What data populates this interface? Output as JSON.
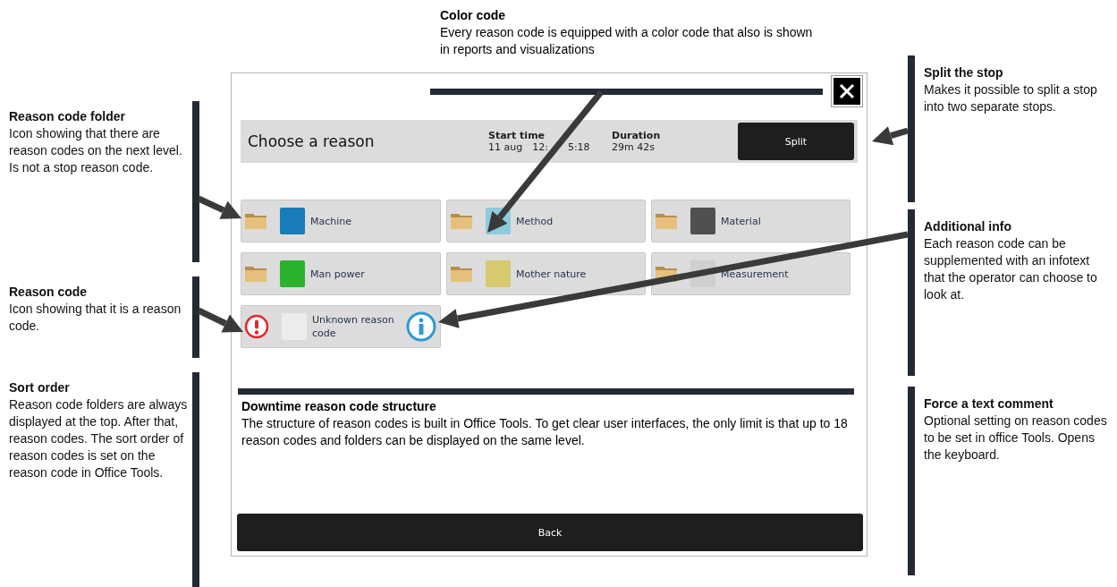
{
  "top_annotation": {
    "title": "Color code",
    "text": "Every reason code is equipped with a color code that also is shown in reports and visualizations"
  },
  "left_annotations": [
    {
      "title": "Reason code folder",
      "text": "Icon showing that there are reason codes on the next level. Is not a stop reason code."
    },
    {
      "title": "Reason code",
      "text": "Icon showing that it is a reason code."
    },
    {
      "title": "Sort order",
      "text": "Reason code folders are always displayed at the top. After that, reason codes. The sort order of reason codes is set on the reason code in Office Tools."
    }
  ],
  "right_annotations": [
    {
      "title": "Split the stop",
      "text": "Makes it possible to split a stop into two separate stops."
    },
    {
      "title": "Additional info",
      "text": "Each reason code can be supplemented with an infotext that the operator can choose to look at."
    },
    {
      "title": "Force a text comment",
      "text": "Optional setting on reason codes to be set in office Tools. Opens the keyboard."
    }
  ],
  "dialog": {
    "title": "Choose a reason",
    "start_time_label": "Start time",
    "start_time_date": "11 aug",
    "start_time_visible": [
      "12:",
      "5:18"
    ],
    "duration_label": "Duration",
    "duration_value": "29m 42s",
    "split_button": "Split",
    "reasons": [
      {
        "kind": "folder",
        "label": "Machine",
        "color": "#1a7bb9",
        "info": false
      },
      {
        "kind": "folder",
        "label": "Method",
        "color": "#8fcbdf",
        "info": false
      },
      {
        "kind": "folder",
        "label": "Material",
        "color": "#505050",
        "info": false
      },
      {
        "kind": "folder",
        "label": "Man power",
        "color": "#2bb32e",
        "info": false
      },
      {
        "kind": "folder",
        "label": "Mother nature",
        "color": "#d6c96f",
        "info": false
      },
      {
        "kind": "folder",
        "label": "Measurement",
        "color": "#cfcfcf",
        "info": false
      },
      {
        "kind": "code",
        "label": "Unknown reason code",
        "color": "#ececec",
        "info": true
      }
    ],
    "structure_note": {
      "title": "Downtime reason code structure",
      "text": "The structure of reason codes is built in Office Tools. To get clear user interfaces, the only limit is that up to 18 reason codes and folders can be displayed on the same level."
    },
    "back_button": "Back"
  }
}
